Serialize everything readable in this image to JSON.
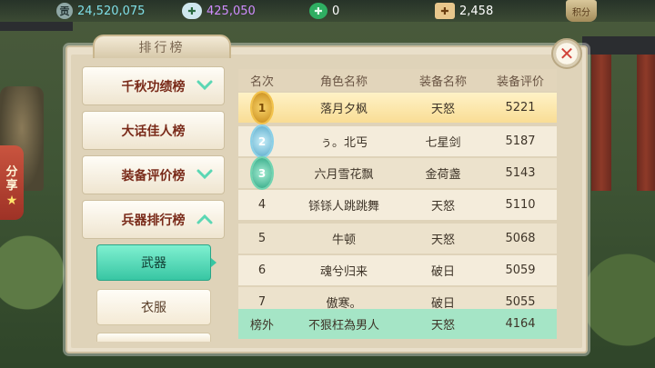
{
  "resources": {
    "silver": {
      "icon": "silver-coin-icon",
      "glyph": "贡",
      "value": "24,520,075",
      "color": "#7fdfe8"
    },
    "gems": {
      "icon": "diamond-icon",
      "value": "425,050",
      "color": "#d08cff"
    },
    "jade": {
      "icon": "jade-icon",
      "value": "0",
      "color": "#ffffff"
    },
    "tickets": {
      "icon": "ticket-icon",
      "value": "2,458",
      "color": "#ffffff"
    }
  },
  "top_right_button": "积分",
  "share_tab": {
    "line1": "分",
    "line2": "享"
  },
  "panel": {
    "title": "排行榜"
  },
  "categories": [
    {
      "label": "千秋功绩榜",
      "expanded": false
    },
    {
      "label": "大话佳人榜",
      "expanded": null
    },
    {
      "label": "装备评价榜",
      "expanded": false
    },
    {
      "label": "兵器排行榜",
      "expanded": true
    }
  ],
  "sub_tabs": [
    {
      "label": "武器",
      "active": true
    },
    {
      "label": "衣服",
      "active": false
    }
  ],
  "table": {
    "headers": [
      "名次",
      "角色名称",
      "装备名称",
      "装备评价"
    ],
    "rows": [
      {
        "rank": "1",
        "name": "落月夕枫",
        "equip": "天怒",
        "score": "5221"
      },
      {
        "rank": "2",
        "name": "ぅ。北丐",
        "equip": "七星剑",
        "score": "5187"
      },
      {
        "rank": "3",
        "name": "六月雪花飘",
        "equip": "金荷盏",
        "score": "5143"
      },
      {
        "rank": "4",
        "name": "铩铩人跳跳舞",
        "equip": "天怒",
        "score": "5110"
      },
      {
        "rank": "5",
        "name": "牛顿",
        "equip": "天怒",
        "score": "5068"
      },
      {
        "rank": "6",
        "name": "魂兮归来",
        "equip": "破日",
        "score": "5059"
      },
      {
        "rank": "7",
        "name": "傲寒。",
        "equip": "破日",
        "score": "5055"
      }
    ],
    "my_row": {
      "rank": "榜外",
      "name": "不狠枉為男人",
      "equip": "天怒",
      "score": "4164"
    }
  }
}
